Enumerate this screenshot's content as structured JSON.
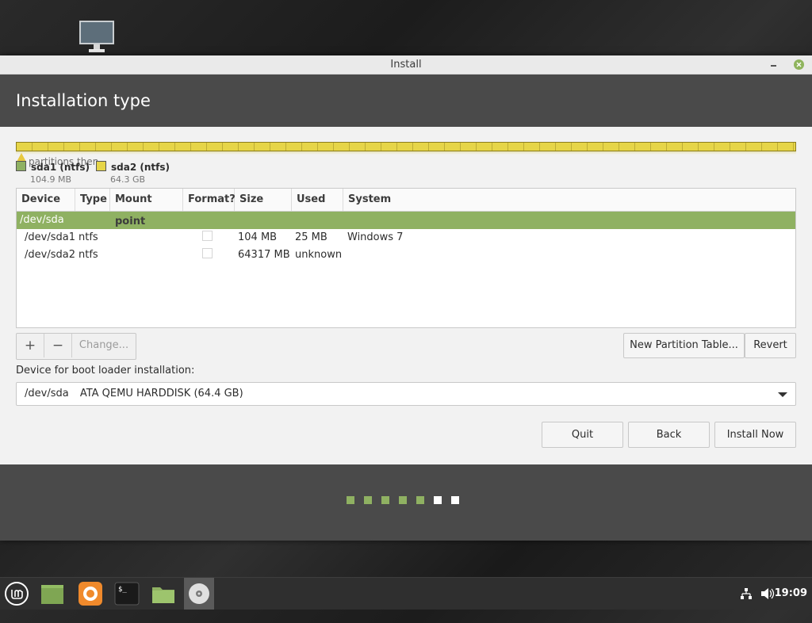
{
  "desktop": {
    "icon": "computer-icon"
  },
  "window": {
    "title": "Install",
    "header_title": "Installation type"
  },
  "partition_bar": {
    "overlap_text": "partitions then",
    "legend": [
      {
        "name": "sda1 (ntfs)",
        "size": "104.9 MB",
        "color": "#8fb162"
      },
      {
        "name": "sda2 (ntfs)",
        "size": "64.3 GB",
        "color": "#e6d548"
      }
    ]
  },
  "table": {
    "columns": [
      "Device",
      "Type",
      "Mount point",
      "Format?",
      "Size",
      "Used",
      "System"
    ],
    "device_row": "/dev/sda",
    "rows": [
      {
        "device": "/dev/sda1",
        "type": "ntfs",
        "mount": "",
        "format": false,
        "size": "104 MB",
        "used": "25 MB",
        "system": "Windows 7"
      },
      {
        "device": "/dev/sda2",
        "type": "ntfs",
        "mount": "",
        "format": false,
        "size": "64317 MB",
        "used": "unknown",
        "system": ""
      }
    ]
  },
  "toolbar": {
    "add": "+",
    "remove": "−",
    "change": "Change...",
    "new_partition_table": "New Partition Table...",
    "revert": "Revert"
  },
  "bootloader": {
    "label": "Device for boot loader installation:",
    "device": "/dev/sda",
    "description": "ATA QEMU HARDDISK (64.4 GB)"
  },
  "actions": {
    "quit": "Quit",
    "back": "Back",
    "install_now": "Install Now"
  },
  "progress": {
    "total_steps": 7,
    "completed_steps": 5,
    "done_color": "#8fb162",
    "todo_color": "#ffffff"
  },
  "taskbar": {
    "apps": [
      "mint-menu-icon",
      "show-desktop-icon",
      "firefox-icon",
      "terminal-icon",
      "files-icon",
      "installer-disc-icon"
    ],
    "tray": [
      "network-icon",
      "volume-icon"
    ],
    "clock": "19:09"
  }
}
